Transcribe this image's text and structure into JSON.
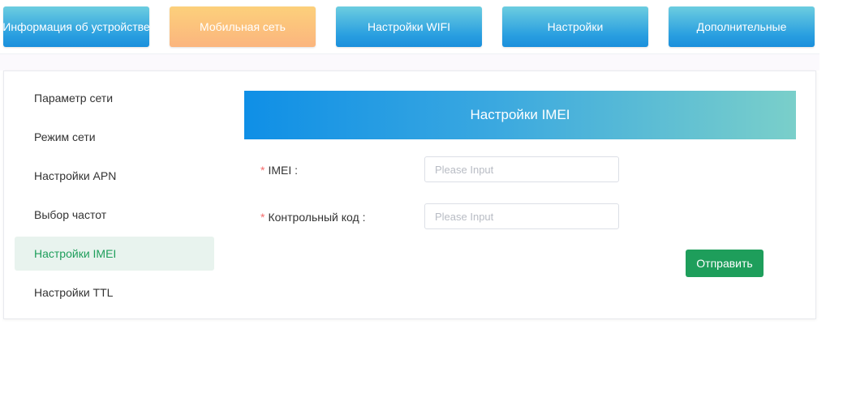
{
  "nav": {
    "tabs": [
      {
        "label": "Информация об устройстве",
        "active": false
      },
      {
        "label": "Мобильная сеть",
        "active": true
      },
      {
        "label": "Настройки WIFI",
        "active": false
      },
      {
        "label": "Настройки",
        "active": false
      },
      {
        "label": "Дополнительные",
        "active": false
      }
    ]
  },
  "sidebar": {
    "items": [
      {
        "label": "Параметр сети"
      },
      {
        "label": "Режим сети"
      },
      {
        "label": "Настройки APN"
      },
      {
        "label": "Выбор частот"
      },
      {
        "label": "Настройки IMEI",
        "active": true
      },
      {
        "label": "Настройки TTL"
      }
    ]
  },
  "panel": {
    "title": "Настройки IMEI"
  },
  "form": {
    "required_mark": "*",
    "imei": {
      "label": "IMEI :",
      "placeholder": "Please Input",
      "value": ""
    },
    "check_code": {
      "label": "Контрольный код :",
      "placeholder": "Please Input",
      "value": ""
    },
    "submit_label": "Отправить"
  },
  "colors": {
    "accent_green": "#1e9e5b",
    "active_tab": "#fbb57e",
    "tab_blue": "#2a9fe0",
    "required": "#f56c6c"
  }
}
